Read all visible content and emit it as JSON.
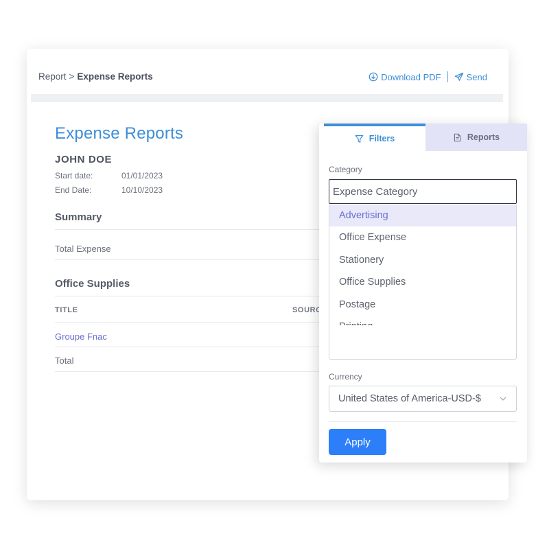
{
  "breadcrumb": {
    "root": "Report",
    "separator": ">",
    "current": "Expense Reports"
  },
  "actions": {
    "download": "Download PDF",
    "send": "Send"
  },
  "report": {
    "title": "Expense Reports",
    "name": "JOHN DOE",
    "start_label": "Start date:",
    "start_value": "01/01/2023",
    "end_label": "End Date:",
    "end_value": "10/10/2023",
    "summary_title": "Summary",
    "total_expense_label": "Total Expense",
    "section_title": "Office Supplies",
    "columns": [
      "TITLE",
      "SOURC"
    ],
    "rows": [
      {
        "title": "Groupe Fnac"
      },
      {
        "title": "Total"
      }
    ]
  },
  "filters": {
    "tabs": [
      {
        "label": "Filters",
        "icon": "filter-icon",
        "active": true
      },
      {
        "label": "Reports",
        "icon": "document-icon",
        "active": false
      }
    ],
    "category_label": "Category",
    "category_placeholder": "Expense Category",
    "category_options": [
      "Advertising",
      "Office Expense",
      "Stationery",
      "Office Supplies",
      "Postage",
      "Printing"
    ],
    "selected_option": "Advertising",
    "currency_label": "Currency",
    "currency_value": "United States of America-USD-$",
    "apply_label": "Apply"
  },
  "colors": {
    "accent": "#3d8ed8",
    "apply_button": "#2d7ff9",
    "highlight": "#e9e9fa",
    "inactive_tab": "#e2e3f6"
  }
}
